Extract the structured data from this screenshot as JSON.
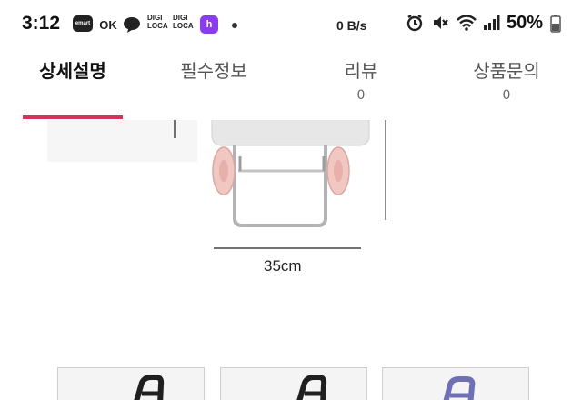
{
  "status_bar": {
    "time": "3:12",
    "apps": [
      "emart",
      "OK",
      "DIGI LOCA",
      "DIGI LOCA",
      "h"
    ],
    "network_speed": "0 B/s",
    "battery": "50%",
    "icons": [
      "alarm-icon",
      "mute-icon",
      "wifi-icon",
      "signal-icon",
      "battery-icon"
    ]
  },
  "tabs": [
    {
      "label": "상세설명",
      "count": "",
      "active": true
    },
    {
      "label": "필수정보",
      "count": "",
      "active": false
    },
    {
      "label": "리뷰",
      "count": "0",
      "active": false
    },
    {
      "label": "상품문의",
      "count": "0",
      "active": false
    }
  ],
  "product_image": {
    "dimension_label": "35cm"
  },
  "colors": {
    "accent": "#d6335a",
    "wheel": "#f1c7c2",
    "frame": "#b9b9b9"
  }
}
